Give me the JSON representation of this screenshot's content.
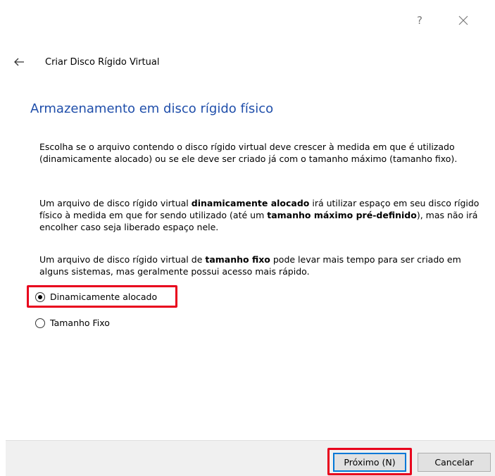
{
  "titlebar": {
    "help_label": "?",
    "help_icon": "question-icon",
    "close_icon": "close-icon"
  },
  "wizard": {
    "back_icon": "arrow-left-icon",
    "title": "Criar Disco Rígido Virtual"
  },
  "page": {
    "heading": "Armazenamento em disco rígido físico",
    "paragraph1": "Escolha se o arquivo contendo o disco rígido virtual deve crescer à medida em que é utilizado (dinamicamente alocado) ou se ele deve ser criado já com o tamanho máximo (tamanho fixo).",
    "paragraph2": {
      "part1": "Um arquivo de disco rígido virtual ",
      "bold1": "dinamicamente alocado",
      "part2": " irá utilizar espaço em seu disco rígido físico à medida em que for sendo utilizado (até um ",
      "bold2": "tamanho máximo pré-definido",
      "part3": "), mas não irá encolher caso seja liberado espaço nele."
    },
    "paragraph3": {
      "part1": "Um arquivo de disco rígido virtual de ",
      "bold1": "tamanho fixo",
      "part2": " pode levar mais tempo para ser criado em alguns sistemas, mas geralmente possui acesso mais rápido."
    }
  },
  "options": {
    "dynamic_label": "Dinamicamente alocado",
    "dynamic_selected": true,
    "fixed_label": "Tamanho Fixo",
    "fixed_selected": false
  },
  "footer": {
    "next_label": "Próximo (N)",
    "cancel_label": "Cancelar"
  },
  "colors": {
    "heading": "#1f4eaa",
    "highlight": "#e8001c",
    "focus_border": "#0078d7"
  }
}
